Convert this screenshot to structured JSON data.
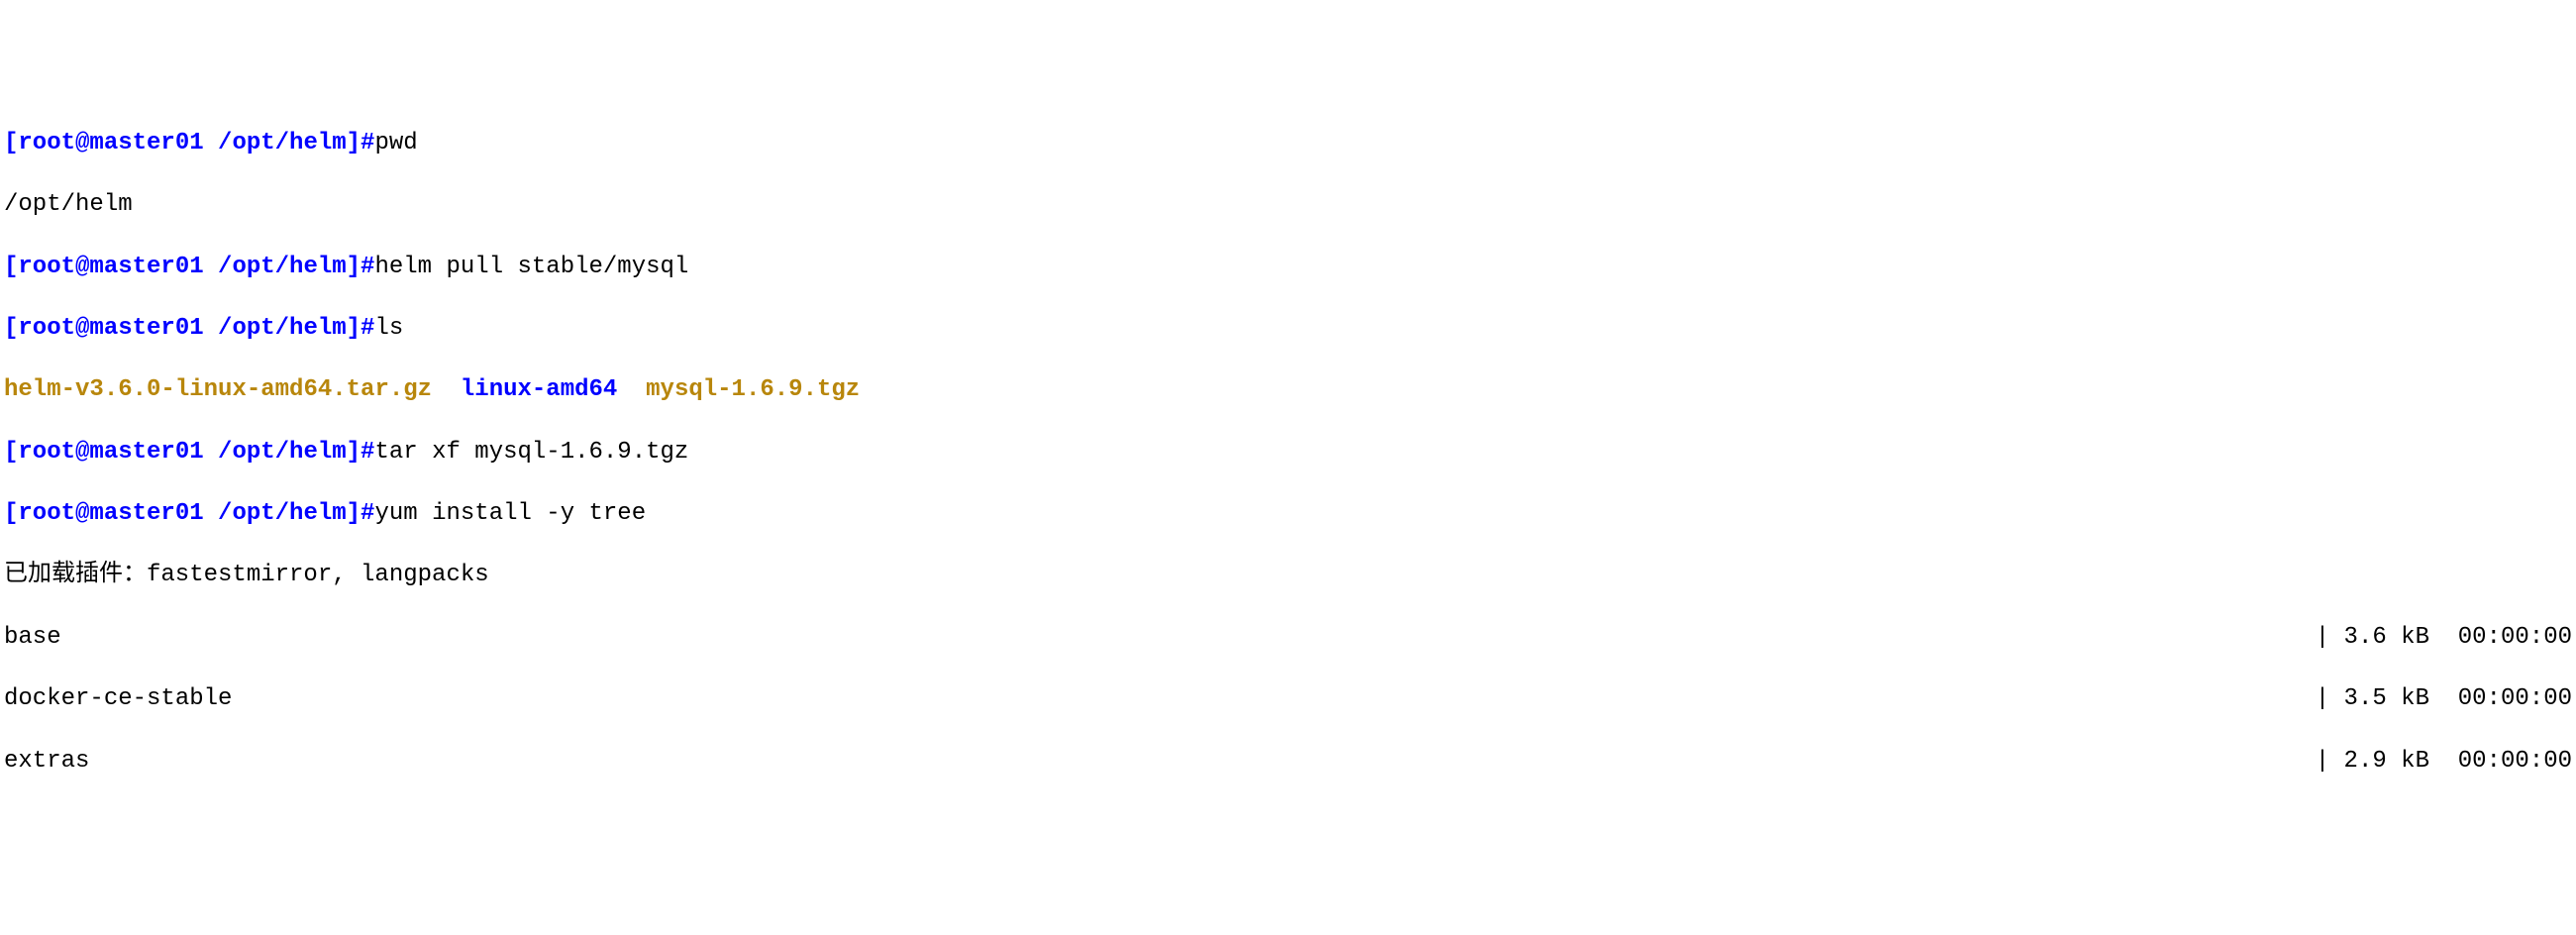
{
  "prompt1": "[root@master01 /opt/helm]#",
  "cmd1": "pwd",
  "out1": "/opt/helm",
  "prompt2": "[root@master01 /opt/helm]#",
  "cmd2": "helm pull stable/mysql",
  "prompt3": "[root@master01 /opt/helm]#",
  "cmd3": "ls",
  "ls": {
    "file1": "helm-v3.6.0-linux-amd64.tar.gz",
    "sep1": "  ",
    "file2": "linux-amd64",
    "sep2": "  ",
    "file3": "mysql-1.6.9.tgz"
  },
  "prompt4": "[root@master01 /opt/helm]#",
  "cmd4": "tar xf mysql-1.6.9.tgz",
  "prompt5": "[root@master01 /opt/helm]#",
  "cmd5": "yum install -y tree",
  "yum": {
    "plugins": "已加载插件：fastestmirror, langpacks",
    "repos": [
      {
        "name": "base",
        "stat": "| 3.6 kB  00:00:00"
      },
      {
        "name": "docker-ce-stable",
        "stat": "| 3.5 kB  00:00:00"
      },
      {
        "name": "extras",
        "stat": "| 2.9 kB  00:00:00"
      }
    ]
  }
}
